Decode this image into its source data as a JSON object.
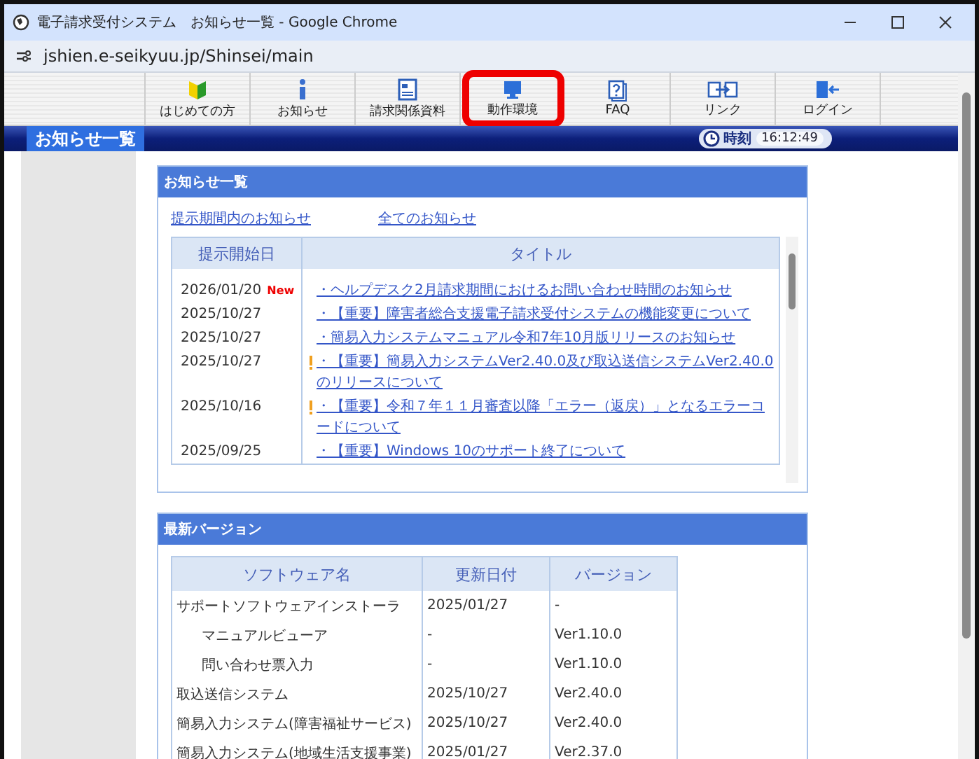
{
  "window": {
    "title": "電子請求受付システム　お知らせ一覧 - Google Chrome"
  },
  "address_bar": {
    "url": "jshien.e-seikyuu.jp/Shinsei/main"
  },
  "toolbar": [
    {
      "label": "はじめての方",
      "kind": "beginner",
      "highlighted": false
    },
    {
      "label": "お知らせ",
      "kind": "info",
      "highlighted": false
    },
    {
      "label": "請求関係資料",
      "kind": "document",
      "highlighted": false
    },
    {
      "label": "動作環境",
      "kind": "monitor",
      "highlighted": true
    },
    {
      "label": "FAQ",
      "kind": "faq",
      "highlighted": false
    },
    {
      "label": "リンク",
      "kind": "link",
      "highlighted": false
    },
    {
      "label": "ログイン",
      "kind": "login",
      "highlighted": false
    }
  ],
  "page_header": {
    "title": "お知らせ一覧",
    "clock_label": "時刻",
    "time": "16:12:49"
  },
  "notices": {
    "title": "お知らせ一覧",
    "links": [
      "提示期間内のお知らせ",
      "全てのお知らせ"
    ],
    "columns": [
      "提示開始日",
      "タイトル"
    ],
    "rows": [
      {
        "date": "2026/01/20",
        "badge": "New",
        "important": false,
        "title": "・ヘルプデスク2月請求期間におけるお問い合わせ時間のお知らせ"
      },
      {
        "date": "2025/10/27",
        "important": false,
        "title": "・【重要】障害者総合支援電子請求受付システムの機能変更について"
      },
      {
        "date": "2025/10/27",
        "important": false,
        "title": "・簡易入力システムマニュアル令和7年10月版リリースのお知らせ"
      },
      {
        "date": "2025/10/27",
        "important": true,
        "title": "・【重要】簡易入力システムVer2.40.0及び取込送信システムVer2.40.0のリリースについて"
      },
      {
        "date": "2025/10/16",
        "important": true,
        "title": "・【重要】令和７年１１月審査以降「エラー（返戻）」となるエラーコードについて"
      },
      {
        "date": "2025/09/25",
        "important": false,
        "title": "・【重要】Windows 10のサポート終了について"
      }
    ]
  },
  "versions": {
    "title": "最新バージョン",
    "columns": [
      "ソフトウェア名",
      "更新日付",
      "バージョン"
    ],
    "rows": [
      {
        "name": "サポートソフトウェアインストーラ",
        "date": "2025/01/27",
        "version": "-",
        "children": [
          {
            "name": "マニュアルビューア",
            "date": "-",
            "version": "Ver1.10.0"
          },
          {
            "name": "問い合わせ票入力",
            "date": "-",
            "version": "Ver1.10.0"
          }
        ]
      },
      {
        "name": "取込送信システム",
        "date": "2025/10/27",
        "version": "Ver2.40.0"
      },
      {
        "name": "簡易入力システム(障害福祉サービス)",
        "date": "2025/10/27",
        "version": "Ver2.40.0"
      },
      {
        "name": "簡易入力システム(地域生活支援事業)",
        "date": "2025/01/27",
        "version": "Ver2.37.0"
      }
    ]
  }
}
